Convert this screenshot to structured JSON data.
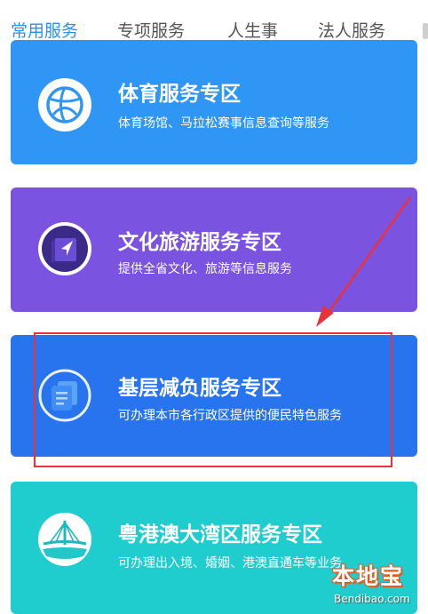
{
  "tabs": [
    {
      "label": "常用服务",
      "active": true
    },
    {
      "label": "专项服务",
      "active": false
    },
    {
      "label": "人生事",
      "active": false
    },
    {
      "label": "法人服务",
      "active": false
    }
  ],
  "cards": {
    "sports": {
      "title": "体育服务专区",
      "desc": "体育场馆、马拉松赛事信息查询等服务",
      "icon": "basketball-icon",
      "color": "#2f96f5"
    },
    "culture": {
      "title": "文化旅游服务专区",
      "desc": "提供全省文化、旅游等信息服务",
      "icon": "navigation-map-icon",
      "color": "#7b53e1"
    },
    "grassroots": {
      "title": "基层减负服务专区",
      "desc": "可办理本市各行政区提供的便民特色服务",
      "icon": "documents-icon",
      "color": "#2873ee"
    },
    "bay": {
      "title": "粤港澳大湾区服务专区",
      "desc": "可办理出入境、婚姻、港澳直通车等业务",
      "icon": "bridge-icon",
      "color": "#1fccce"
    }
  },
  "annotation": {
    "box_color": "#e8333a",
    "arrow_color": "#e8333a"
  },
  "watermark": {
    "logo": "本地宝",
    "url": "Bendibao.com"
  },
  "colors": {
    "accent": "#2f8ef4",
    "tab_text": "#555555"
  }
}
